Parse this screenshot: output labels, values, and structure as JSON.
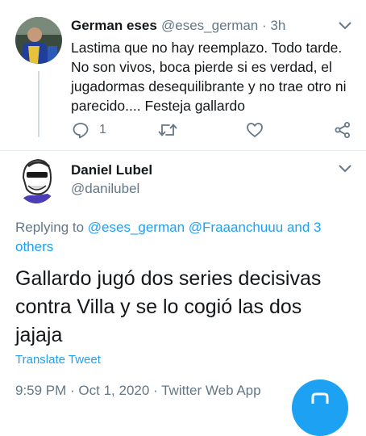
{
  "tweet1": {
    "name": "German eses",
    "handle": "@eses_german",
    "time": "· 3h",
    "text": "Lastima que no hay reemplazo. Todo tarde. No son vivos, boca pierde si es verdad, el jugadormas desequilibrante y no trae otro ni parecido.... Festeja gallardo",
    "reply_count": "1"
  },
  "tweet2": {
    "name": "Daniel Lubel",
    "handle": "@danilubel",
    "replying_prefix": "Replying to ",
    "replying_user1": "@eses_german",
    "replying_user2": "@Fraaanchuuu",
    "replying_others": "and 3 others",
    "text": "Gallardo jugó dos series decisivas contra Villa y se lo cogió las dos jajaja",
    "translate": "Translate Tweet",
    "meta": "9:59 PM · Oct 1, 2020 · Twitter Web App"
  },
  "colors": {
    "accent": "#1da1f2",
    "secondary_text": "#657786",
    "primary_text": "#14171a"
  },
  "icons": [
    "chevron-down-icon",
    "reply-icon",
    "retweet-icon",
    "like-icon",
    "share-icon",
    "compose-icon"
  ]
}
